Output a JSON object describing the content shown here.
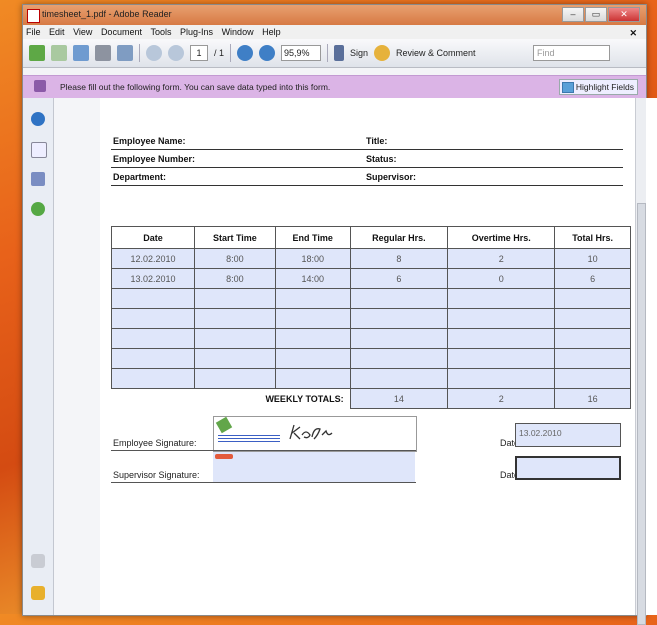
{
  "window": {
    "title": "timesheet_1.pdf - Adobe Reader"
  },
  "menu": [
    "File",
    "Edit",
    "View",
    "Document",
    "Tools",
    "Plug-Ins",
    "Window",
    "Help"
  ],
  "toolbar": {
    "page_current": "1",
    "page_total": "/ 1",
    "zoom": "95,9%",
    "sign_label": "Sign",
    "review_label": "Review & Comment",
    "find_placeholder": "Find"
  },
  "formbar": {
    "message": "Please fill out the following form. You can save data typed into this form.",
    "highlight_label": "Highlight Fields"
  },
  "form": {
    "employee_name_label": "Employee Name:",
    "employee_number_label": "Employee Number:",
    "department_label": "Department:",
    "title_label": "Title:",
    "status_label": "Status:",
    "supervisor_label": "Supervisor:",
    "columns": [
      "Date",
      "Start Time",
      "End Time",
      "Regular Hrs.",
      "Overtime Hrs.",
      "Total Hrs."
    ],
    "rows": [
      [
        "12.02.2010",
        "8:00",
        "18:00",
        "8",
        "2",
        "10"
      ],
      [
        "13.02.2010",
        "8:00",
        "14:00",
        "6",
        "0",
        "6"
      ],
      [
        "",
        "",
        "",
        "",
        "",
        ""
      ],
      [
        "",
        "",
        "",
        "",
        "",
        ""
      ],
      [
        "",
        "",
        "",
        "",
        "",
        ""
      ],
      [
        "",
        "",
        "",
        "",
        "",
        ""
      ],
      [
        "",
        "",
        "",
        "",
        "",
        ""
      ]
    ],
    "totals_label": "WEEKLY TOTALS:",
    "totals": [
      "14",
      "2",
      "16"
    ],
    "employee_signature_label": "Employee Signature:",
    "supervisor_signature_label": "Supervisor Signature:",
    "date_label_1": "Date:",
    "date_label_2": "Date:",
    "employee_date_value": "13.02.2010",
    "supervisor_date_value": ""
  },
  "colors": {
    "accent": "#dbb4e6",
    "field_fill": "#dfe6fa"
  }
}
